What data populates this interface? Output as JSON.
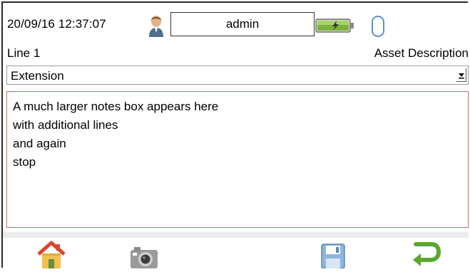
{
  "header": {
    "datetime": "20/09/16 12:37:07",
    "username": "admin",
    "icons": {
      "user": "user-avatar-icon",
      "battery": "battery-charging-icon",
      "status": "status-pill-icon"
    }
  },
  "form": {
    "line_label": "Line 1",
    "asset_label": "Asset Description",
    "select_value": "Extension",
    "notes": {
      "lines": [
        "A much larger notes box appears here",
        "with additional lines",
        "and again",
        "stop"
      ]
    }
  },
  "footer": {
    "icons": [
      "home-icon",
      "camera-icon",
      "save-icon",
      "return-icon"
    ]
  },
  "colors": {
    "notes_border": "#e06464",
    "return_arrow": "#5aa82e",
    "battery_fill": "#7bb33a"
  }
}
